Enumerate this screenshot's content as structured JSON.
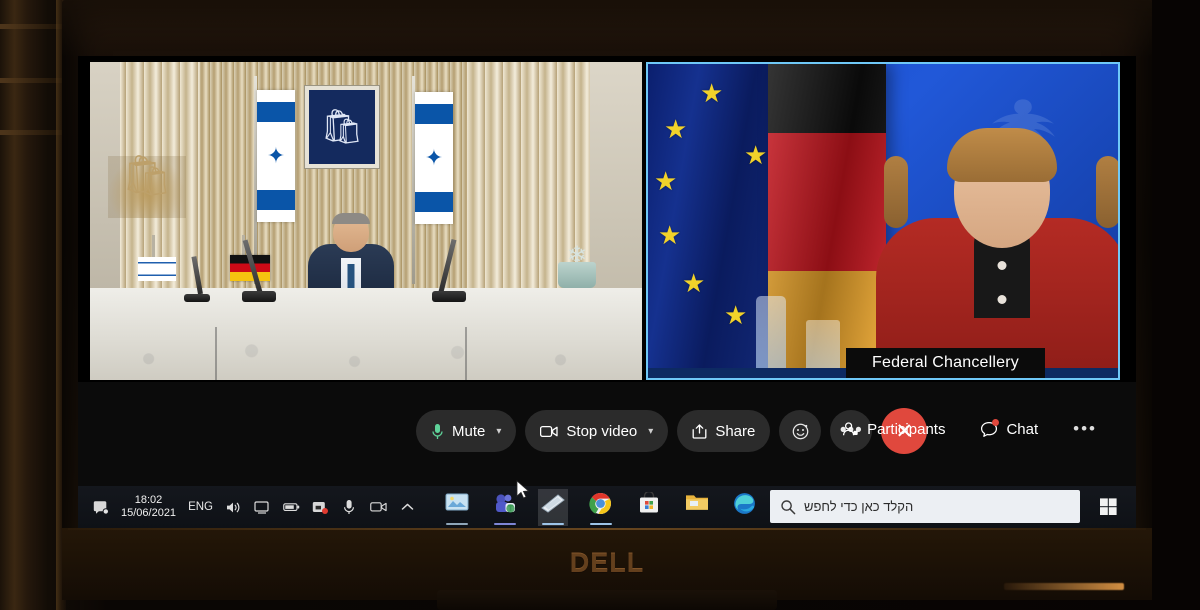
{
  "scene": {
    "device_brand": "DELL",
    "description": "Dell monitor showing a Zoom video call between the Israeli President and the German Federal Chancellery"
  },
  "meeting": {
    "tiles": [
      {
        "id": "tile-left",
        "name_label": "",
        "active_speaker": false,
        "scene": "Israeli President seated at a white damask-covered table with Israeli flags, state menorah emblem and German and Israeli desk flags in front of a gold curtain"
      },
      {
        "id": "tile-right",
        "name_label": "Federal Chancellery",
        "active_speaker": true,
        "scene": "German Chancellor in a red jacket in front of the EU flag and the German flag on a blue backdrop with the federal eagle"
      }
    ],
    "active_border_color": "#6fc8f7"
  },
  "controls": {
    "left": [
      {
        "name": "mute",
        "label": "Mute",
        "icon": "microphone-icon",
        "has_caret": true,
        "icon_color": "#5fd39a"
      },
      {
        "name": "video",
        "label": "Stop video",
        "icon": "camera-icon",
        "has_caret": true,
        "icon_color": "#ffffff"
      },
      {
        "name": "share",
        "label": "Share",
        "icon": "share-icon",
        "has_caret": false,
        "icon_color": "#ffffff"
      }
    ],
    "round": [
      {
        "name": "reactions",
        "icon": "smiley-icon",
        "label": ""
      },
      {
        "name": "more-options",
        "icon": "ellipsis-icon",
        "label": "•••"
      }
    ],
    "leave": {
      "name": "leave-call",
      "icon": "close-icon",
      "glyph": "✕",
      "color": "#e0483d"
    },
    "right": [
      {
        "name": "participants",
        "label": "Participants",
        "icon": "people-icon",
        "badge": false
      },
      {
        "name": "chat",
        "label": "Chat",
        "icon": "chat-bubble-icon",
        "badge": true
      },
      {
        "name": "more",
        "label": "•••",
        "icon": "ellipsis-icon",
        "badge": false
      }
    ]
  },
  "taskbar": {
    "clock": {
      "time": "18:02",
      "date": "15/06/2021"
    },
    "language": "ENG",
    "tray_icons": [
      "action-center-icon",
      "volume-icon",
      "display-icon",
      "battery-icon",
      "camera-privacy-icon",
      "microphone-icon",
      "meeting-icon",
      "show-hidden-icons-icon"
    ],
    "apps": [
      {
        "name": "photos-app",
        "icon": "photos-icon",
        "active": false,
        "running": true
      },
      {
        "name": "teams-app",
        "icon": "teams-icon",
        "active": false,
        "running": true
      },
      {
        "name": "zoom-app",
        "icon": "zoom-icon",
        "active": true,
        "running": true
      },
      {
        "name": "chrome-app",
        "icon": "chrome-icon",
        "active": false,
        "running": true
      },
      {
        "name": "microsoft-store-app",
        "icon": "store-icon",
        "active": false,
        "running": false
      },
      {
        "name": "file-explorer-app",
        "icon": "folder-icon",
        "active": false,
        "running": false
      },
      {
        "name": "edge-app",
        "icon": "edge-icon",
        "active": false,
        "running": false
      },
      {
        "name": "movies-app",
        "icon": "film-icon",
        "active": false,
        "running": false
      },
      {
        "name": "cortana-app",
        "icon": "circle-icon",
        "active": false,
        "running": false
      }
    ],
    "search": {
      "placeholder": "הקלד כאן כדי לחפש",
      "icon": "search-icon"
    },
    "start": {
      "name": "start-button",
      "icon": "windows-logo-icon"
    }
  }
}
